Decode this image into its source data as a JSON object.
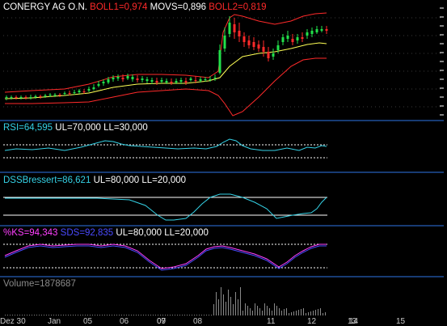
{
  "colors": {
    "background": "#000000",
    "divider": "#173b73",
    "white": "#ffffff",
    "red": "#ff2a2a",
    "yellow": "#ffff55",
    "cyan": "#35d2e6",
    "blue": "#4a4aff",
    "magenta": "#ff3fff",
    "gray": "#8a8a8a",
    "green": "#22e04a",
    "grid": "#3a3a3a"
  },
  "price": {
    "title": "CONERGY AG O.N.",
    "boll1_label": "BOLL1=0,974",
    "movs_label": "MOVS=0,896",
    "boll2_label": "BOLL2=0,819"
  },
  "rsi": {
    "label": "RSI=64,595",
    "ul_label": "UL=70,000",
    "ll_label": "LL=30,000"
  },
  "dss": {
    "label": "DSSBressert=86,621",
    "ul_label": "UL=80,000",
    "ll_label": "LL=20,000"
  },
  "stoch": {
    "ks_label": "%KS=94,343",
    "sds_label": "SDS=92,835",
    "ul_label": "UL=80,000",
    "ll_label": "LL=20,000"
  },
  "volume": {
    "label": "Volume=1878687"
  },
  "x_axis": {
    "labels": [
      "Dez 30",
      "Jan",
      "05",
      "06",
      "07",
      "08",
      "09",
      "10",
      "11",
      "12",
      "13",
      "14",
      "15"
    ]
  },
  "chart_data": [
    {
      "type": "line",
      "title": "CONERGY AG O.N.",
      "series": [
        {
          "name": "BOLL1"
        },
        {
          "name": "MOVS"
        },
        {
          "name": "BOLL2"
        }
      ]
    },
    {
      "type": "line",
      "series": [
        {
          "name": "RSI"
        }
      ],
      "ul": 70,
      "ll": 30
    },
    {
      "type": "line",
      "series": [
        {
          "name": "DSSBressert"
        }
      ],
      "ul": 80,
      "ll": 20
    },
    {
      "type": "line",
      "series": [
        {
          "name": "%KS"
        },
        {
          "name": "SDS"
        }
      ],
      "ul": 80,
      "ll": 20
    },
    {
      "type": "bar",
      "series": [
        {
          "name": "Volume"
        }
      ]
    }
  ]
}
